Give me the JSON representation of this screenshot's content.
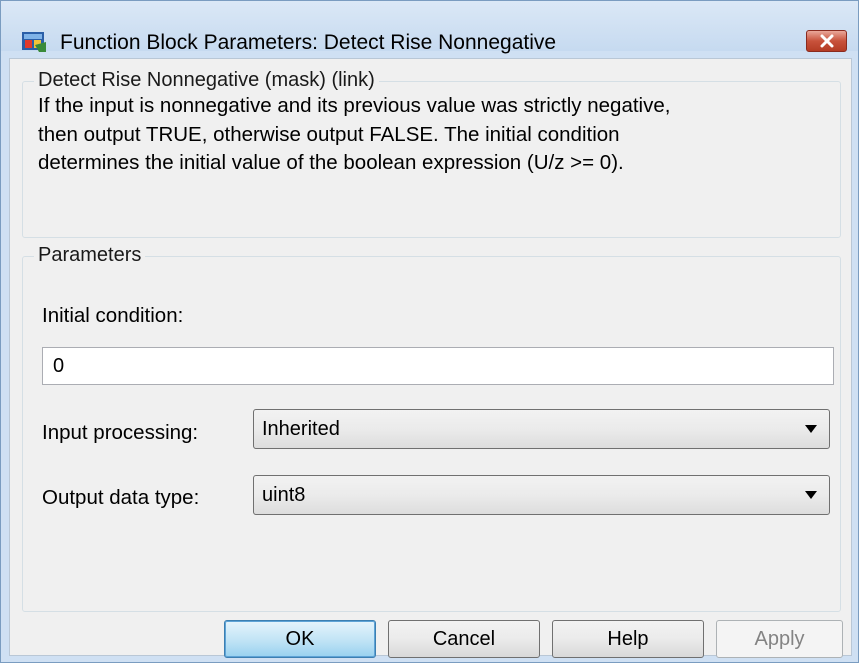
{
  "window": {
    "title": "Function Block Parameters: Detect Rise Nonnegative",
    "app_icon": "simulink-block-icon",
    "close_icon": "close-icon"
  },
  "description_group": {
    "legend": "Detect Rise Nonnegative (mask) (link)",
    "lines": [
      "If the input is nonnegative and its previous value was strictly negative,",
      "then output TRUE, otherwise output FALSE.  The initial condition",
      "determines the initial value of the boolean expression (U/z >= 0)."
    ]
  },
  "parameters_group": {
    "legend": "Parameters",
    "initial_condition": {
      "label": "Initial condition:",
      "value": "0"
    },
    "input_processing": {
      "label": "Input processing:",
      "selected": "Inherited"
    },
    "output_data_type": {
      "label": "Output data type:",
      "selected": "uint8"
    }
  },
  "buttons": {
    "ok": "OK",
    "cancel": "Cancel",
    "help": "Help",
    "apply": "Apply"
  },
  "colors": {
    "title_bar": "#c6daf0",
    "close_button": "#c8523b",
    "dialog_bg": "#f0f0f0",
    "default_button": "#c4e5f6"
  }
}
